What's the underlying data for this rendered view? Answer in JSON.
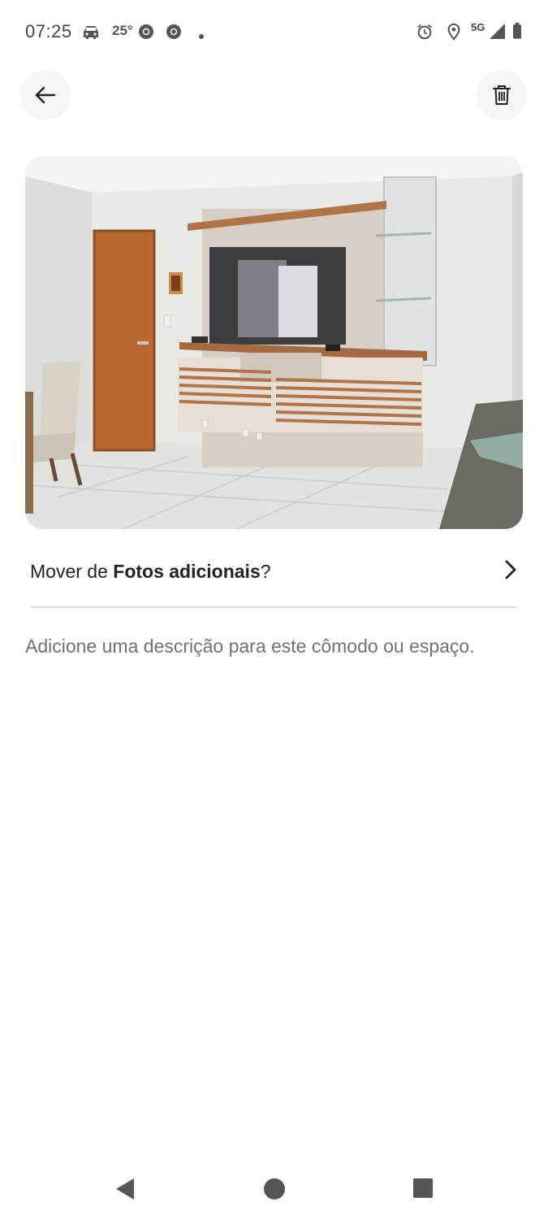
{
  "status_bar": {
    "time": "07:25",
    "temperature": "25°",
    "network": "5G",
    "icons": [
      "car-icon",
      "chrome-icon",
      "chrome-icon",
      "dot-icon",
      "alarm-icon",
      "location-icon",
      "signal-icon",
      "battery-icon"
    ]
  },
  "header": {
    "back_icon": "arrow-left-icon",
    "delete_icon": "trash-icon"
  },
  "photo": {
    "subject": "living room"
  },
  "move": {
    "prefix": "Mover de ",
    "album": "Fotos adicionais",
    "suffix": "?"
  },
  "description": {
    "placeholder": "Adicione uma descrição para este cômodo ou espaço."
  },
  "nav": {
    "icons": [
      "back-triangle-icon",
      "home-circle-icon",
      "recents-square-icon"
    ]
  },
  "colors": {
    "text": "#222222",
    "muted": "#717171",
    "divider": "#dddddd",
    "button_bg": "#f5f5f5"
  }
}
